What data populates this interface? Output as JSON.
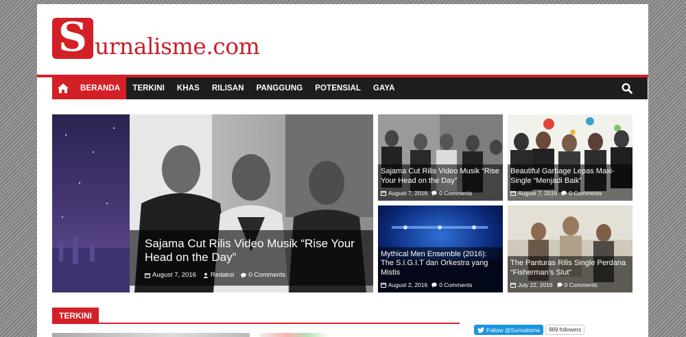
{
  "site": {
    "logo_letter": "S",
    "logo_text": "urnalisme.com",
    "brand_color": "#d32027"
  },
  "nav": {
    "home_icon": "home-icon",
    "items": [
      {
        "label": "BERANDA",
        "active": true
      },
      {
        "label": "TERKINI"
      },
      {
        "label": "KHAS"
      },
      {
        "label": "RILISAN"
      },
      {
        "label": "PANGGUNG"
      },
      {
        "label": "POTENSIAL"
      },
      {
        "label": "GAYA"
      }
    ],
    "search_icon": "search-icon"
  },
  "featured": {
    "main": {
      "title": "Sajama Cut Rilis Video Musik “Rise Your Head on the Day”",
      "date": "August 7, 2016",
      "author": "Redaksi",
      "comments": "0 Comments"
    },
    "side": [
      {
        "title": "Sajama Cut Rilis Video Musik “Rise Your Head on the Day”",
        "date": "August 7, 2016",
        "comments": "0 Comments"
      },
      {
        "title": "Beautiful Garbage Lepas Maxi-Single “Menjadi Baik”",
        "date": "August 7, 2016",
        "comments": "0 Comments"
      },
      {
        "title": "Mythical Men Ensemble (2016): The S.I.G.I.T dan Orkestra yang Mistis",
        "date": "August 2, 2016",
        "comments": "0 Comments"
      },
      {
        "title": "The Panturas Rilis Single Perdana “Fisherman’s Slut”",
        "date": "July 22, 2016",
        "comments": "0 Comments"
      }
    ]
  },
  "section": {
    "label": "TERKINI"
  },
  "twitter": {
    "follow_label": "Follow @Surnalisme",
    "followers": "969 followers"
  }
}
